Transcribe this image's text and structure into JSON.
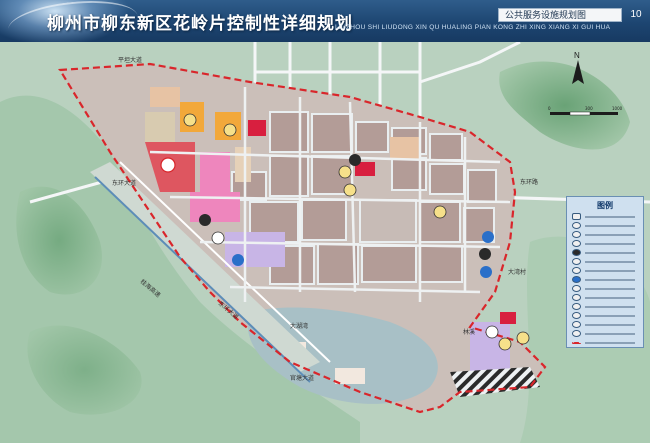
{
  "header": {
    "title_cn": "柳州市柳东新区花岭片控制性详细规划",
    "title_en": "LIUZHOU SHI LIUDONG XIN QU HUALING PIAN KONG ZHI XING XIANG XI GUI HUA",
    "sheet_name": "公共服务设施规划图",
    "sheet_number": "10"
  },
  "map": {
    "compass_label": "N",
    "scale_ticks": [
      "0",
      "300",
      "1000"
    ],
    "place_labels": {
      "lake": "大湖湾",
      "east_village": "大湾村",
      "east_road": "东环路",
      "north_road": "平坦大道",
      "west_road": "东环大道",
      "south_road": "官塘大道",
      "diagonal_road_1": "桂海高速",
      "diagonal_road_2": "东环大道",
      "south_east_label": "林溪"
    },
    "colors": {
      "planning_boundary": "#d9262b",
      "water": "#a8c0c6",
      "hills": "#7fb089",
      "residential": "#b39c97",
      "commercial": "#ee86bd",
      "education": "#f2a83a",
      "medical": "#e23c4a",
      "culture": "#c8b5e6"
    }
  },
  "legend": {
    "title": "图例",
    "items": [
      {
        "symbol": "rect"
      },
      {
        "symbol": "circle-a"
      },
      {
        "symbol": "circle-b"
      },
      {
        "symbol": "circle-c"
      },
      {
        "symbol": "circle-d"
      },
      {
        "symbol": "circle-e"
      },
      {
        "symbol": "circle-f"
      },
      {
        "symbol": "circle-g"
      },
      {
        "symbol": "circle-h"
      },
      {
        "symbol": "circle-i"
      },
      {
        "symbol": "circle-j"
      },
      {
        "symbol": "circle-k"
      },
      {
        "symbol": "circle-l"
      },
      {
        "symbol": "circle-m"
      },
      {
        "symbol": "boundary-dash"
      }
    ]
  }
}
